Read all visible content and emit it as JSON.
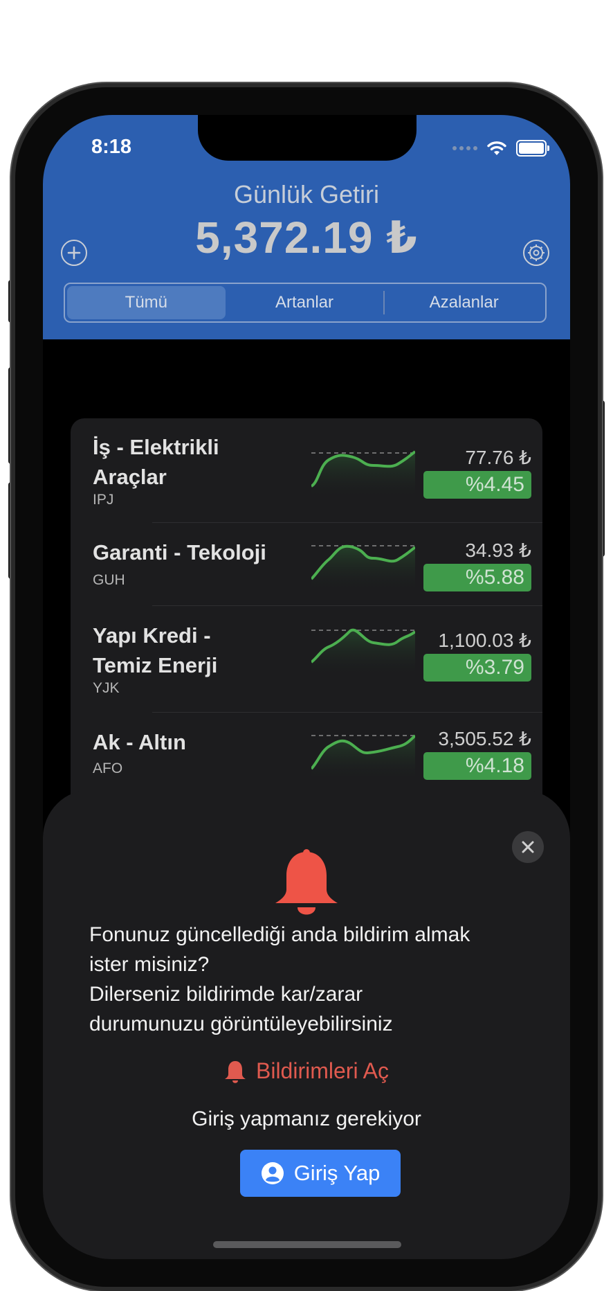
{
  "status_bar": {
    "time": "8:18"
  },
  "header": {
    "title": "Günlük Getiri",
    "value": "5,372.19 ₺",
    "add_icon": "plus-circle-icon",
    "settings_icon": "gear-icon"
  },
  "segments": [
    {
      "label": "Tümü",
      "active": true
    },
    {
      "label": "Artanlar",
      "active": false
    },
    {
      "label": "Azalanlar",
      "active": false
    }
  ],
  "funds": [
    {
      "name_line1": "İş - Elektrikli",
      "name_line2": "Araçlar",
      "code": "IPJ",
      "price": "77.76 ₺",
      "change": "%4.45"
    },
    {
      "name_line1": "Garanti - Tekoloji",
      "name_line2": "",
      "code": "GUH",
      "price": "34.93 ₺",
      "change": "%5.88"
    },
    {
      "name_line1": "Yapı Kredi -",
      "name_line2": "Temiz Enerji",
      "code": "YJK",
      "price": "1,100.03 ₺",
      "change": "%3.79"
    },
    {
      "name_line1": "Ak - Altın",
      "name_line2": "",
      "code": "AFO",
      "price": "3,505.52 ₺",
      "change": "%4.18"
    }
  ],
  "sheet": {
    "message_lines": [
      "Fonunuz güncellediği anda bildirim almak",
      "ister misiniz?",
      "Dilerseniz bildirimde kar/zarar",
      "durumunuzu görüntüleyebilirsiniz"
    ],
    "enable_notifications": "Bildirimleri Aç",
    "login_required": "Giriş yapmanız gerekiyor",
    "login_button": "Giriş Yap"
  },
  "colors": {
    "header_bg": "#2c5fb0",
    "positive": "#3f9a4a",
    "accent_red": "#e05a4f",
    "button_blue": "#3b82f6"
  }
}
